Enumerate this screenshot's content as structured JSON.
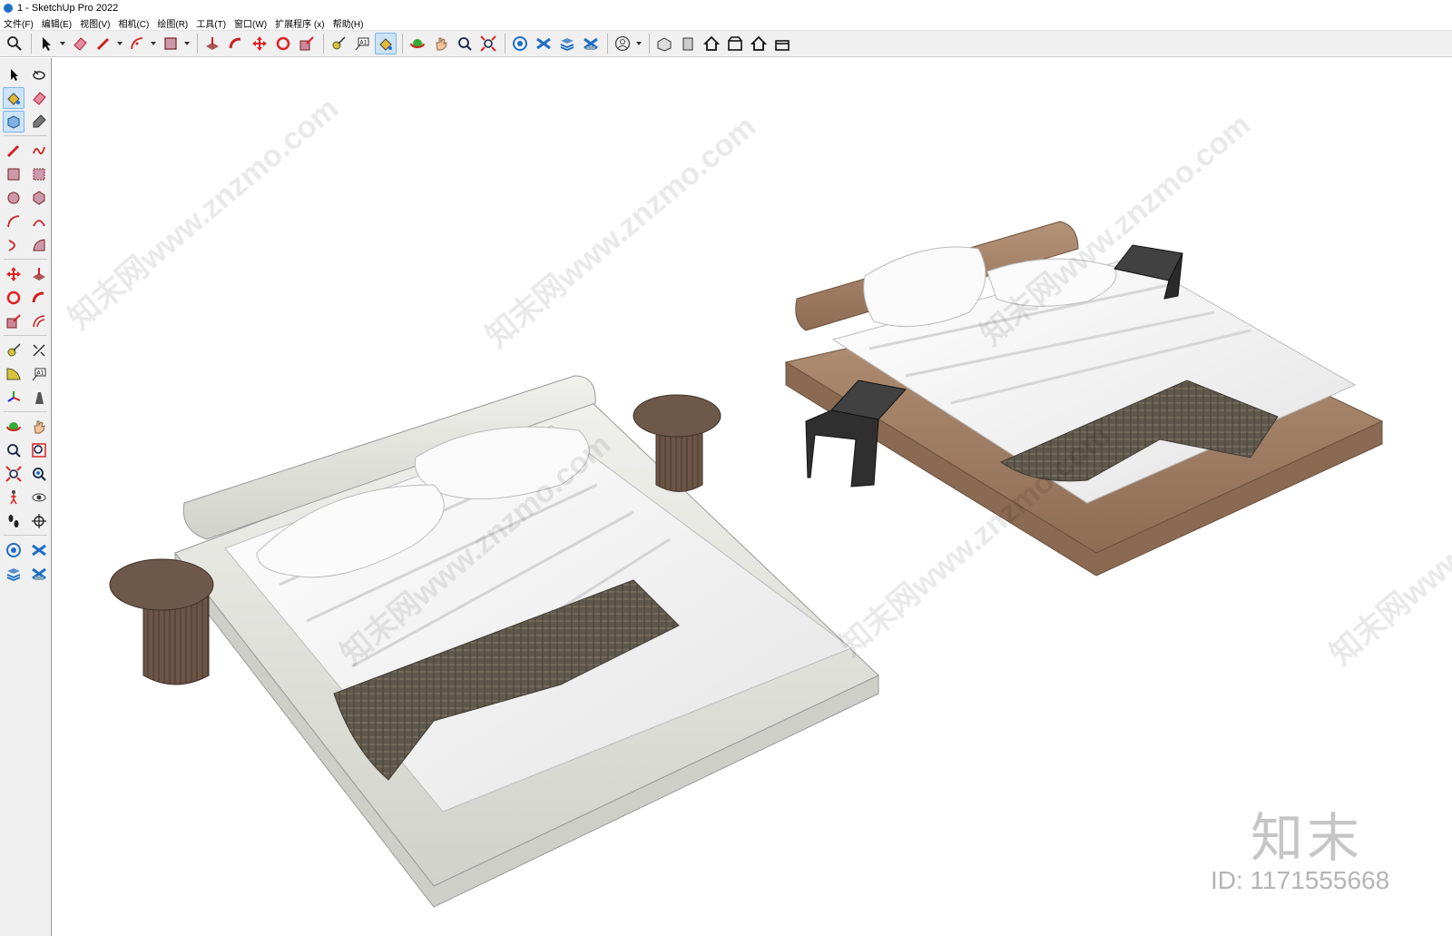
{
  "window": {
    "title": "1 - SketchUp Pro 2022"
  },
  "menu": {
    "items": [
      "文件(F)",
      "编辑(E)",
      "视图(V)",
      "相机(C)",
      "绘图(R)",
      "工具(T)",
      "窗口(W)",
      "扩展程序 (x)",
      "帮助(H)"
    ]
  },
  "toolbar": {
    "icons": [
      "zoom-icon",
      "select-icon",
      "eraser-icon",
      "pencil-icon",
      "arc-icon",
      "rectangle-icon",
      "push-pull-icon",
      "follow-me-icon",
      "move-icon",
      "rotate-icon",
      "scale-icon",
      "tape-measure-icon",
      "text-icon",
      "paint-bucket-icon",
      "orbit-icon",
      "pan-icon",
      "zoom-window-icon",
      "zoom-extents-icon",
      "warehouse-icon",
      "extension-icon",
      "layers-icon",
      "sandbox-icon",
      "account-icon",
      "iso-view-icon",
      "front-view-icon",
      "home-icon",
      "right-view-icon",
      "back-view-icon",
      "left-view-icon"
    ],
    "active": "paint-bucket-icon"
  },
  "side_toolbar": {
    "rows": [
      [
        "select-icon",
        "orbit-lasso-icon"
      ],
      [
        "paint-bucket-icon",
        "eraser-icon"
      ],
      [
        "component-icon",
        "tag-icon"
      ],
      [
        "pencil-icon",
        "freehand-icon"
      ],
      [
        "rectangle-icon",
        "rotated-rectangle-icon"
      ],
      [
        "circle-icon",
        "polygon-icon"
      ],
      [
        "arc-icon",
        "two-point-arc-icon"
      ],
      [
        "three-point-arc-icon",
        "pie-icon"
      ],
      [
        "move-icon",
        "push-pull-icon"
      ],
      [
        "rotate-icon",
        "follow-me-icon"
      ],
      [
        "scale-icon",
        "offset-icon"
      ],
      [
        "tape-measure-icon",
        "dimension-icon"
      ],
      [
        "protractor-icon",
        "text-icon"
      ],
      [
        "axes-icon",
        "3d-text-icon"
      ],
      [
        "orbit-icon",
        "pan-icon"
      ],
      [
        "zoom-icon",
        "zoom-window-icon"
      ],
      [
        "zoom-extents-icon",
        "position-camera-icon"
      ],
      [
        "walk-icon",
        "look-around-icon"
      ],
      [
        "footprints-icon",
        "section-plane-icon"
      ],
      [
        "warehouse-icon",
        "extension-warehouse-icon"
      ],
      [
        "layers-icon",
        "sandbox-icon"
      ]
    ],
    "active": [
      "paint-bucket-icon",
      "component-icon"
    ]
  },
  "watermarks": {
    "site": "知末网www.znzmo.com",
    "logo": "知末",
    "id": "ID: 1171555668"
  },
  "colors": {
    "toolbar_bg": "#f0f0f0",
    "active_bg": "#cce4f7",
    "bed1_frame": "#e7e7e2",
    "bed2_frame": "#a17e64",
    "sheet": "#f2f2f2",
    "throw": "#5e574c",
    "side_table_wood": "#6b5547",
    "side_table_black": "#3b3b3b"
  }
}
